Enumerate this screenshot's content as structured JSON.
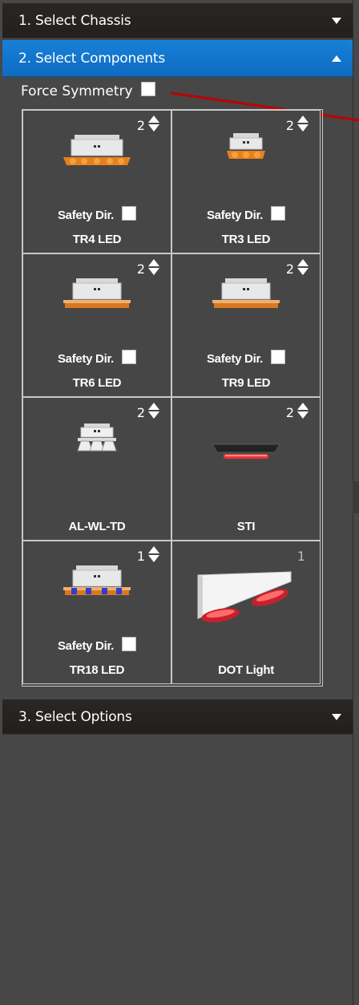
{
  "accordion": {
    "chassis": {
      "label": "1. Select Chassis"
    },
    "components": {
      "label": "2. Select Components"
    },
    "options": {
      "label": "3. Select Options"
    }
  },
  "force_symmetry": {
    "label": "Force Symmetry",
    "checked": false
  },
  "safety_label": "Safety Dir.",
  "components": [
    {
      "name": "TR4 LED",
      "qty": "2",
      "has_stepper": true,
      "has_safety": true,
      "icon": "lightbar-amber-icon"
    },
    {
      "name": "TR3 LED",
      "qty": "2",
      "has_stepper": true,
      "has_safety": true,
      "icon": "lightbar-amber-small-icon"
    },
    {
      "name": "TR6 LED",
      "qty": "2",
      "has_stepper": true,
      "has_safety": true,
      "icon": "lightbar-slim-icon"
    },
    {
      "name": "TR9 LED",
      "qty": "2",
      "has_stepper": true,
      "has_safety": true,
      "icon": "lightbar-slim-icon"
    },
    {
      "name": "AL-WL-TD",
      "qty": "2",
      "has_stepper": true,
      "has_safety": false,
      "icon": "work-light-icon"
    },
    {
      "name": "STI",
      "qty": "2",
      "has_stepper": true,
      "has_safety": false,
      "icon": "stop-light-icon"
    },
    {
      "name": "TR18 LED",
      "qty": "1",
      "has_stepper": true,
      "has_safety": true,
      "icon": "lightbar-blue-amber-icon"
    },
    {
      "name": "DOT Light",
      "qty": "1",
      "has_stepper": false,
      "has_safety": false,
      "icon": "dot-light-icon"
    }
  ],
  "colors": {
    "active_header": "#1780d9",
    "header": "#242120",
    "panel": "#474747",
    "amber": "#e8801a",
    "red": "#e8323a",
    "blue": "#2a3fd6",
    "annotation_line": "#c00000"
  }
}
